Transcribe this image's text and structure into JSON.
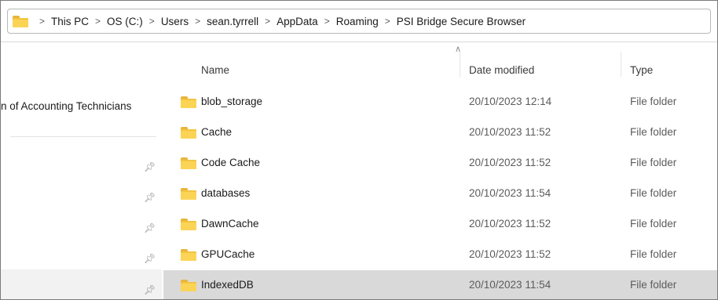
{
  "breadcrumb": [
    "This PC",
    "OS (C:)",
    "Users",
    "sean.tyrrell",
    "AppData",
    "Roaming",
    "PSI Bridge Secure Browser"
  ],
  "nav": {
    "org_label": "n of Accounting Technicians"
  },
  "columns": {
    "name": "Name",
    "date": "Date modified",
    "type": "Type"
  },
  "files": [
    {
      "name": "blob_storage",
      "date": "20/10/2023 12:14",
      "type": "File folder"
    },
    {
      "name": "Cache",
      "date": "20/10/2023 11:52",
      "type": "File folder"
    },
    {
      "name": "Code Cache",
      "date": "20/10/2023 11:52",
      "type": "File folder"
    },
    {
      "name": "databases",
      "date": "20/10/2023 11:54",
      "type": "File folder"
    },
    {
      "name": "DawnCache",
      "date": "20/10/2023 11:52",
      "type": "File folder"
    },
    {
      "name": "GPUCache",
      "date": "20/10/2023 11:52",
      "type": "File folder"
    },
    {
      "name": "IndexedDB",
      "date": "20/10/2023 11:54",
      "type": "File folder"
    }
  ],
  "selected_file": "IndexedDB",
  "icons": {
    "sort": "chevron-up-icon",
    "pin": "pin-icon",
    "folder": "folder-icon"
  }
}
